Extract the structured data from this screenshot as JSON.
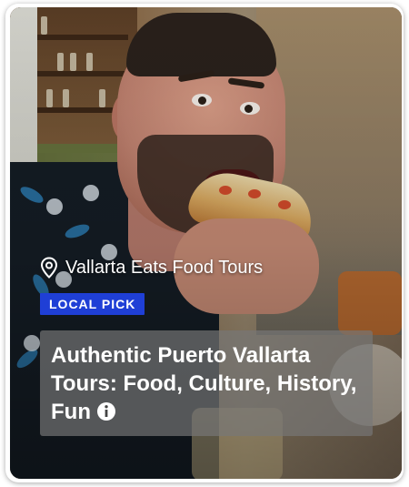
{
  "card": {
    "location": "Vallarta Eats Food Tours",
    "badge": "LOCAL PICK",
    "title": "Authentic Puerto Vallarta Tours: Food, Culture, History, Fun",
    "icons": {
      "location": "map-pin-icon",
      "info": "info-icon"
    },
    "colors": {
      "badge_bg": "#1f3fd6",
      "text": "#ffffff",
      "title_box_bg": "rgba(120,120,120,0.68)"
    }
  }
}
